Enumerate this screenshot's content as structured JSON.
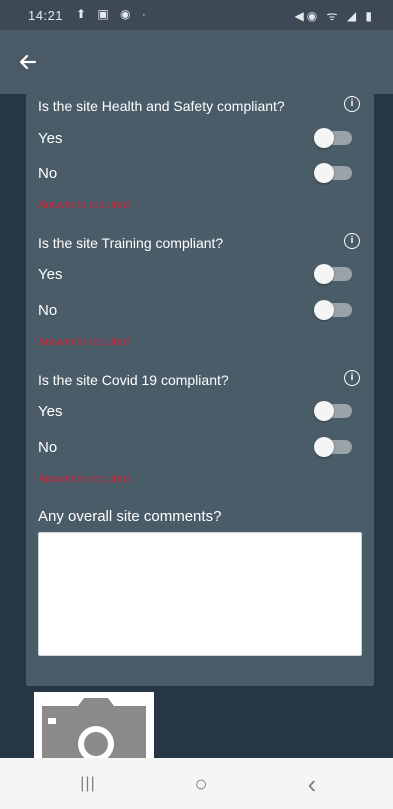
{
  "status_bar": {
    "time": "14:21",
    "left_icons": "⬆ ▣ ◉ ·",
    "right_icons": "◀◉ ᯤ ◢ ▮"
  },
  "app_bar": {
    "back_icon": "arrow-back-icon"
  },
  "form": {
    "questions": [
      {
        "question": "Is the site Health and Safety compliant?",
        "yes_label": "Yes",
        "no_label": "No",
        "yes_on": false,
        "no_on": false,
        "error": "Answer is required"
      },
      {
        "question": "Is the site Training compliant?",
        "yes_label": "Yes",
        "no_label": "No",
        "yes_on": false,
        "no_on": false,
        "error": "Answer is required"
      },
      {
        "question": "Is the site Covid 19 compliant?",
        "yes_label": "Yes",
        "no_label": "No",
        "yes_on": false,
        "no_on": false,
        "error": "Answer is required"
      }
    ],
    "comments_label": "Any overall site comments?",
    "comments_value": ""
  },
  "photo": {
    "icon": "camera-icon"
  },
  "nav_bar": {
    "recents": "|||",
    "home": "○",
    "back": "‹"
  },
  "colors": {
    "background": "#263646",
    "card": "#4b5c69",
    "error": "#c2263a"
  }
}
